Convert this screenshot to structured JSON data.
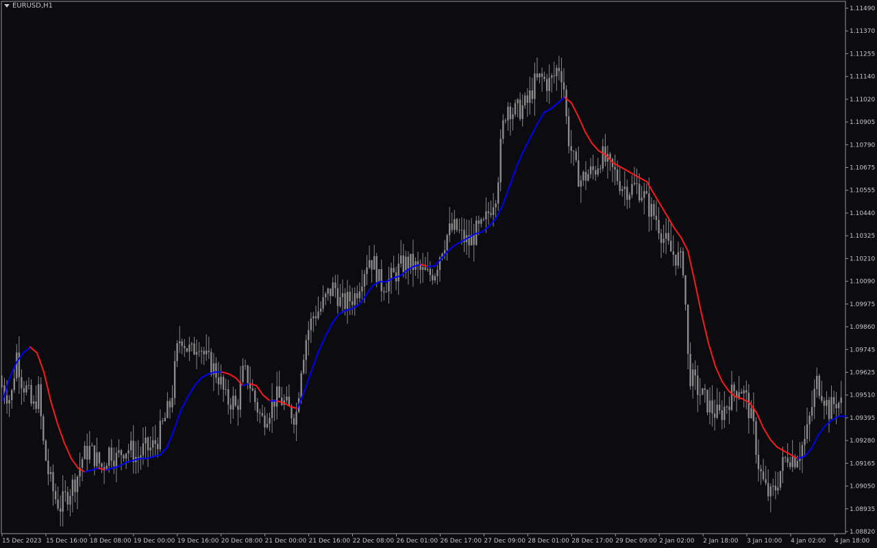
{
  "window": {
    "symbol_title": "EURUSD,H1"
  },
  "colors": {
    "background": "#0b0b10",
    "grid_frame": "#9a9a9a",
    "candle": "#8c8c8c",
    "ma_up": "#0000ff",
    "ma_down": "#ff1a1a",
    "text": "#c8c8c8"
  },
  "chart_data": {
    "type": "candlestick",
    "symbol": "EURUSD",
    "timeframe": "H1",
    "y_axis": {
      "range": [
        1.0882,
        1.1155
      ],
      "ticks": [
        "1.11490",
        "1.11370",
        "1.11255",
        "1.11140",
        "1.11020",
        "1.10905",
        "1.10790",
        "1.10675",
        "1.10555",
        "1.10440",
        "1.10325",
        "1.10210",
        "1.10090",
        "1.09975",
        "1.09860",
        "1.09745",
        "1.09625",
        "1.09510",
        "1.09395",
        "1.09280",
        "1.09165",
        "1.09050",
        "1.08935",
        "1.08820"
      ]
    },
    "x_axis": {
      "ticks": [
        "15 Dec 2023",
        "15 Dec 16:00",
        "18 Dec 08:00",
        "19 Dec 00:00",
        "19 Dec 16:00",
        "20 Dec 08:00",
        "21 Dec 00:00",
        "21 Dec 16:00",
        "22 Dec 08:00",
        "26 Dec 01:00",
        "26 Dec 17:00",
        "27 Dec 09:00",
        "28 Dec 01:00",
        "28 Dec 17:00",
        "29 Dec 09:00",
        "2 Jan 02:00",
        "2 Jan 18:00",
        "3 Jan 10:00",
        "4 Jan 02:00",
        "4 Jan 18:00"
      ]
    },
    "price_path": [
      [
        0,
        1.096
      ],
      [
        8,
        1.0955
      ],
      [
        16,
        1.095
      ],
      [
        24,
        1.0975
      ],
      [
        32,
        1.096
      ],
      [
        40,
        1.0955
      ],
      [
        48,
        1.0945
      ],
      [
        56,
        1.0955
      ],
      [
        64,
        1.0925
      ],
      [
        72,
        1.091
      ],
      [
        80,
        1.09
      ],
      [
        88,
        1.0895
      ],
      [
        96,
        1.09
      ],
      [
        104,
        1.0905
      ],
      [
        112,
        1.091
      ],
      [
        120,
        1.092
      ],
      [
        130,
        1.0925
      ],
      [
        140,
        1.092
      ],
      [
        150,
        1.0915
      ],
      [
        160,
        1.0925
      ],
      [
        170,
        1.092
      ],
      [
        180,
        1.0925
      ],
      [
        190,
        1.0925
      ],
      [
        200,
        1.092
      ],
      [
        210,
        1.0925
      ],
      [
        220,
        1.0925
      ],
      [
        230,
        1.093
      ],
      [
        240,
        1.094
      ],
      [
        250,
        1.095
      ],
      [
        258,
        1.0975
      ],
      [
        264,
        1.0985
      ],
      [
        272,
        1.0978
      ],
      [
        280,
        1.0975
      ],
      [
        290,
        1.0982
      ],
      [
        300,
        1.0972
      ],
      [
        310,
        1.0968
      ],
      [
        320,
        1.0962
      ],
      [
        330,
        1.095
      ],
      [
        340,
        1.095
      ],
      [
        345,
        1.0945
      ],
      [
        355,
        1.0965
      ],
      [
        362,
        1.0962
      ],
      [
        372,
        1.095
      ],
      [
        382,
        1.094
      ],
      [
        392,
        1.0945
      ],
      [
        402,
        1.0952
      ],
      [
        412,
        1.095
      ],
      [
        422,
        1.0945
      ],
      [
        432,
        1.0942
      ],
      [
        440,
        1.097
      ],
      [
        448,
        1.0985
      ],
      [
        458,
        1.0995
      ],
      [
        468,
        1.0998
      ],
      [
        478,
        1.1005
      ],
      [
        488,
        1.101
      ],
      [
        498,
        1.1
      ],
      [
        508,
        1.1002
      ],
      [
        518,
        1.1005
      ],
      [
        528,
        1.1015
      ],
      [
        538,
        1.1025
      ],
      [
        548,
        1.102
      ],
      [
        555,
        1.101
      ],
      [
        565,
        1.1012
      ],
      [
        575,
        1.1015
      ],
      [
        585,
        1.102
      ],
      [
        595,
        1.1022
      ],
      [
        605,
        1.102
      ],
      [
        615,
        1.1017
      ],
      [
        625,
        1.1015
      ],
      [
        635,
        1.1018
      ],
      [
        645,
        1.103
      ],
      [
        655,
        1.1038
      ],
      [
        665,
        1.104
      ],
      [
        675,
        1.1035
      ],
      [
        685,
        1.1032
      ],
      [
        695,
        1.1038
      ],
      [
        705,
        1.104
      ],
      [
        715,
        1.105
      ],
      [
        725,
        1.106
      ],
      [
        733,
        1.109
      ],
      [
        740,
        1.1105
      ],
      [
        750,
        1.11
      ],
      [
        760,
        1.1102
      ],
      [
        770,
        1.1105
      ],
      [
        780,
        1.1115
      ],
      [
        790,
        1.1118
      ],
      [
        800,
        1.1115
      ],
      [
        808,
        1.1118
      ],
      [
        815,
        1.1125
      ],
      [
        822,
        1.1118
      ],
      [
        828,
        1.109
      ],
      [
        834,
        1.108
      ],
      [
        840,
        1.107
      ],
      [
        848,
        1.1065
      ],
      [
        858,
        1.1068
      ],
      [
        868,
        1.107
      ],
      [
        878,
        1.1078
      ],
      [
        888,
        1.1072
      ],
      [
        898,
        1.1068
      ],
      [
        908,
        1.1062
      ],
      [
        918,
        1.106
      ],
      [
        928,
        1.1062
      ],
      [
        938,
        1.1058
      ],
      [
        948,
        1.105
      ],
      [
        958,
        1.1045
      ],
      [
        968,
        1.1035
      ],
      [
        978,
        1.1028
      ],
      [
        988,
        1.1025
      ],
      [
        998,
        1.102
      ],
      [
        1005,
        1.0965
      ],
      [
        1012,
        1.096
      ],
      [
        1020,
        1.0955
      ],
      [
        1030,
        1.095
      ],
      [
        1040,
        1.0945
      ],
      [
        1050,
        1.0942
      ],
      [
        1060,
        1.0948
      ],
      [
        1070,
        1.0955
      ],
      [
        1080,
        1.0958
      ],
      [
        1090,
        1.095
      ],
      [
        1100,
        1.0935
      ],
      [
        1108,
        1.0915
      ],
      [
        1116,
        1.0905
      ],
      [
        1124,
        1.09
      ],
      [
        1132,
        1.0905
      ],
      [
        1140,
        1.0915
      ],
      [
        1150,
        1.0922
      ],
      [
        1160,
        1.092
      ],
      [
        1168,
        1.0925
      ],
      [
        1176,
        1.093
      ],
      [
        1184,
        1.0945
      ],
      [
        1192,
        1.096
      ],
      [
        1200,
        1.0955
      ],
      [
        1210,
        1.0945
      ],
      [
        1220,
        1.095
      ],
      [
        1230,
        1.0948
      ]
    ],
    "ma_path": [
      [
        0,
        1.095
      ],
      [
        10,
        1.0962
      ],
      [
        20,
        1.097
      ],
      [
        30,
        1.0975
      ],
      [
        40,
        1.0978
      ],
      [
        50,
        1.0975
      ],
      [
        60,
        1.0965
      ],
      [
        70,
        1.095
      ],
      [
        80,
        1.0938
      ],
      [
        90,
        1.0928
      ],
      [
        100,
        1.092
      ],
      [
        110,
        1.0915
      ],
      [
        120,
        1.0913
      ],
      [
        130,
        1.0914
      ],
      [
        140,
        1.0915
      ],
      [
        150,
        1.0914
      ],
      [
        160,
        1.0915
      ],
      [
        170,
        1.0916
      ],
      [
        180,
        1.0918
      ],
      [
        190,
        1.0919
      ],
      [
        200,
        1.092
      ],
      [
        210,
        1.092
      ],
      [
        220,
        1.0921
      ],
      [
        230,
        1.0922
      ],
      [
        240,
        1.0926
      ],
      [
        250,
        1.0935
      ],
      [
        260,
        1.0945
      ],
      [
        270,
        1.0952
      ],
      [
        280,
        1.0958
      ],
      [
        290,
        1.0962
      ],
      [
        300,
        1.0964
      ],
      [
        310,
        1.0965
      ],
      [
        320,
        1.0965
      ],
      [
        330,
        1.0964
      ],
      [
        340,
        1.0962
      ],
      [
        350,
        1.0958
      ],
      [
        360,
        1.0959
      ],
      [
        370,
        1.0958
      ],
      [
        380,
        1.0953
      ],
      [
        390,
        1.095
      ],
      [
        400,
        1.095
      ],
      [
        410,
        1.0949
      ],
      [
        420,
        1.0947
      ],
      [
        430,
        1.0946
      ],
      [
        440,
        1.0955
      ],
      [
        450,
        1.0965
      ],
      [
        460,
        1.0975
      ],
      [
        470,
        1.0983
      ],
      [
        480,
        1.099
      ],
      [
        490,
        1.0995
      ],
      [
        500,
        1.0997
      ],
      [
        510,
        1.0998
      ],
      [
        520,
        1.1
      ],
      [
        530,
        1.1005
      ],
      [
        540,
        1.101
      ],
      [
        550,
        1.1012
      ],
      [
        560,
        1.1012
      ],
      [
        570,
        1.1014
      ],
      [
        580,
        1.1015
      ],
      [
        590,
        1.1018
      ],
      [
        600,
        1.102
      ],
      [
        610,
        1.1021
      ],
      [
        620,
        1.102
      ],
      [
        630,
        1.102
      ],
      [
        640,
        1.1024
      ],
      [
        650,
        1.1028
      ],
      [
        660,
        1.1031
      ],
      [
        670,
        1.1033
      ],
      [
        680,
        1.1035
      ],
      [
        690,
        1.1037
      ],
      [
        700,
        1.1038
      ],
      [
        710,
        1.1041
      ],
      [
        720,
        1.1045
      ],
      [
        730,
        1.1052
      ],
      [
        740,
        1.1062
      ],
      [
        750,
        1.1072
      ],
      [
        760,
        1.108
      ],
      [
        770,
        1.1087
      ],
      [
        780,
        1.1094
      ],
      [
        790,
        1.11
      ],
      [
        800,
        1.1102
      ],
      [
        810,
        1.1105
      ],
      [
        820,
        1.1108
      ],
      [
        830,
        1.1105
      ],
      [
        840,
        1.1098
      ],
      [
        850,
        1.109
      ],
      [
        860,
        1.1084
      ],
      [
        870,
        1.108
      ],
      [
        880,
        1.1078
      ],
      [
        890,
        1.1074
      ],
      [
        900,
        1.1072
      ],
      [
        910,
        1.107
      ],
      [
        920,
        1.1068
      ],
      [
        930,
        1.1066
      ],
      [
        940,
        1.1064
      ],
      [
        950,
        1.1058
      ],
      [
        960,
        1.1052
      ],
      [
        970,
        1.1046
      ],
      [
        980,
        1.104
      ],
      [
        990,
        1.1035
      ],
      [
        1000,
        1.1028
      ],
      [
        1010,
        1.1012
      ],
      [
        1020,
        1.0995
      ],
      [
        1030,
        1.098
      ],
      [
        1040,
        1.0968
      ],
      [
        1050,
        1.096
      ],
      [
        1060,
        1.0955
      ],
      [
        1070,
        1.0952
      ],
      [
        1080,
        1.0951
      ],
      [
        1090,
        1.0949
      ],
      [
        1100,
        1.0944
      ],
      [
        1110,
        1.0936
      ],
      [
        1120,
        1.093
      ],
      [
        1130,
        1.0926
      ],
      [
        1140,
        1.0924
      ],
      [
        1150,
        1.0922
      ],
      [
        1160,
        1.092
      ],
      [
        1170,
        1.0921
      ],
      [
        1180,
        1.0925
      ],
      [
        1190,
        1.0932
      ],
      [
        1200,
        1.0937
      ],
      [
        1210,
        1.094
      ],
      [
        1220,
        1.0942
      ],
      [
        1230,
        1.0942
      ]
    ],
    "ma_segments_direction": "red when slope falling, blue when rising"
  }
}
